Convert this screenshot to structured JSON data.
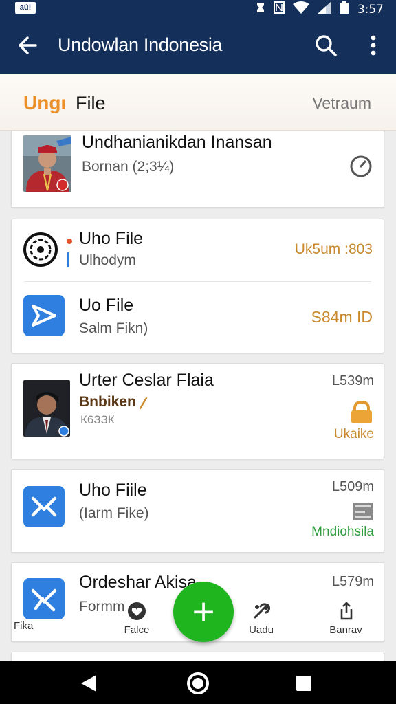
{
  "status_bar": {
    "left_icon_text": "aú!",
    "icons": [
      "notification-icon",
      "nfc-icon",
      "wifi-icon",
      "signal-icon",
      "battery-icon"
    ],
    "time": "3:57"
  },
  "app_bar": {
    "title": "Undowlan Indonesia",
    "background": "#14305a"
  },
  "subheader": {
    "brand": "Ungı",
    "section": "File",
    "action": "Vetraum",
    "accent": "#e9902a"
  },
  "items": [
    {
      "name": "Undhanianikdan Inansan",
      "sub": "Bornan (2;3¼)",
      "icon": "clock-icon"
    },
    {
      "name": "Uho File",
      "sub": "Ulhodym",
      "meta": "Uk5um :803",
      "meta_color": "#c9892c"
    },
    {
      "name": "Uo File",
      "sub": "Salm Fikn)",
      "meta": "S84m ID",
      "meta_color": "#c9892c"
    },
    {
      "name": "Urter Ceslar Flaia",
      "sub": "Bnbiken",
      "sub2": "К6ЗЗК",
      "meta": "L539m",
      "tag": "Ukaike",
      "tag_color": "#c9892c",
      "icon": "lock-icon"
    },
    {
      "name": "Uho Fiile",
      "sub": "(Iarm Fike)",
      "meta": "L509m",
      "tag": "Mndiohsila",
      "tag_color": "#2e9b3e",
      "icon": "storage-icon"
    },
    {
      "name": "Ordeshar Akisa",
      "sub": "Formm",
      "meta": "L579m"
    }
  ],
  "bottom_tabs": [
    {
      "label": "Fika"
    },
    {
      "label": "Falce"
    },
    {
      "label": "Uadu"
    },
    {
      "label": "Banrav"
    }
  ],
  "fab": {
    "symbol": "+",
    "color": "#1fb51f"
  }
}
